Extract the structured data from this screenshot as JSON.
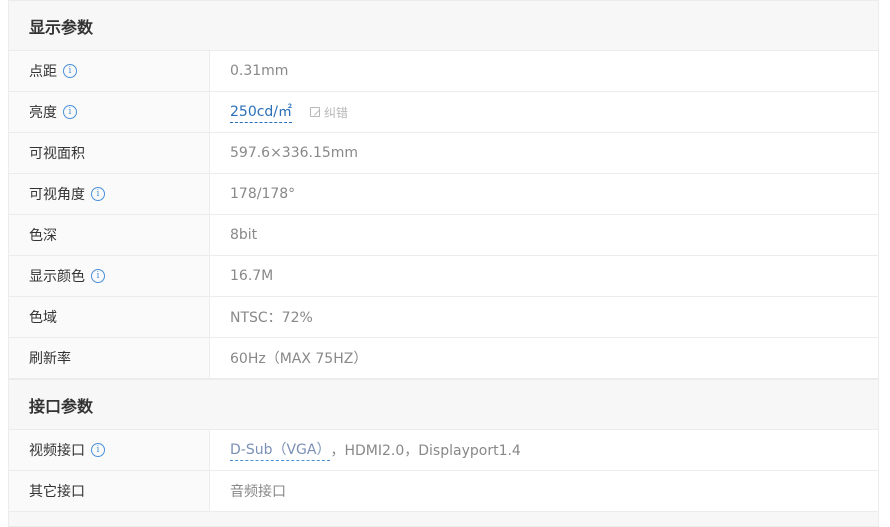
{
  "sections": [
    {
      "title": "显示参数",
      "rows": [
        {
          "label": "点距",
          "info": true,
          "value": "0.31mm"
        },
        {
          "label": "亮度",
          "info": true,
          "value": "250cd/㎡",
          "link": true,
          "correct_label": "纠错"
        },
        {
          "label": "可视面积",
          "info": false,
          "value": "597.6×336.15mm"
        },
        {
          "label": "可视角度",
          "info": true,
          "value": "178/178°"
        },
        {
          "label": "色深",
          "info": false,
          "value": "8bit"
        },
        {
          "label": "显示颜色",
          "info": true,
          "value": "16.7M"
        },
        {
          "label": "色域",
          "info": false,
          "value": "NTSC：72%"
        },
        {
          "label": "刷新率",
          "info": false,
          "value": "60Hz（MAX 75HZ）"
        }
      ]
    },
    {
      "title": "接口参数",
      "rows": [
        {
          "label": "视频接口",
          "info": true,
          "value_link": "D-Sub（VGA）",
          "value_rest": "，HDMI2.0，Displayport1.4"
        },
        {
          "label": "其它接口",
          "info": false,
          "value": "音频接口"
        }
      ]
    }
  ],
  "info_icon_glyph": "i",
  "colors": {
    "link": "#2a6fb8",
    "info": "#4a90d9",
    "value_text": "#888888",
    "header_bg": "#f7f7f7"
  }
}
